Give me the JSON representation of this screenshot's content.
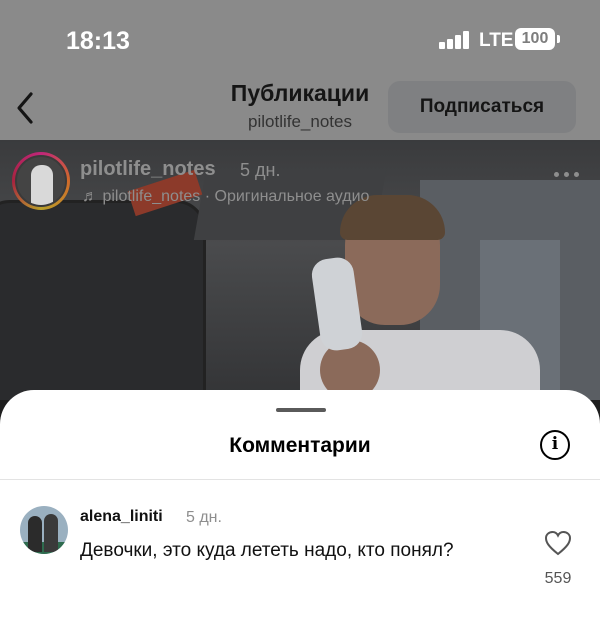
{
  "status_bar": {
    "time": "18:13",
    "network": "LTE",
    "battery": "100"
  },
  "header": {
    "title": "Публикации",
    "subtitle": "pilotlife_notes",
    "subscribe_label": "Подписаться"
  },
  "post": {
    "username": "pilotlife_notes",
    "time": "5 дн.",
    "audio": "♬ pilotlife_notes · Оригинальное аудио"
  },
  "comments_sheet": {
    "title": "Комментарии",
    "info_symbol": "i",
    "comments": [
      {
        "username": "alena_liniti",
        "time": "5 дн.",
        "text": "Девочки, это куда лететь надо, кто понял?",
        "likes": "559"
      }
    ]
  },
  "icons": [
    "back-chevron-icon",
    "signal-icon",
    "battery-icon",
    "more-icon",
    "info-icon",
    "heart-icon",
    "music-note-icon"
  ]
}
